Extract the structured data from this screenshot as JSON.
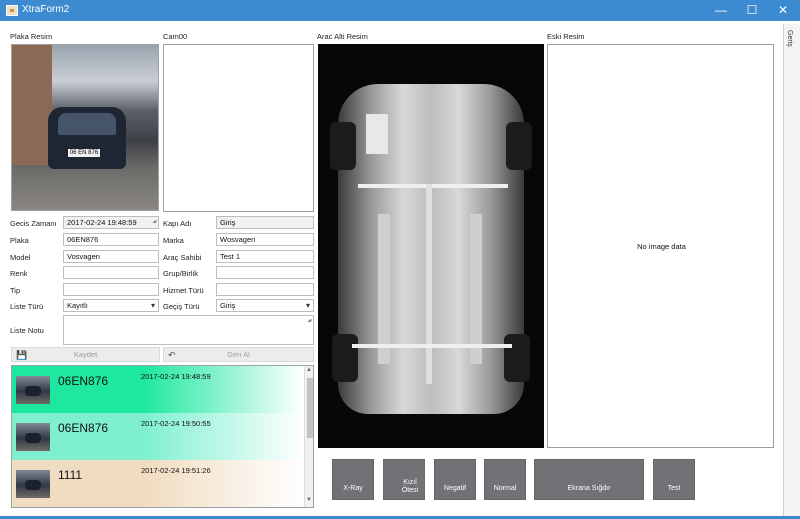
{
  "window": {
    "title": "XtraForm2",
    "minimize": "—",
    "maximize": "☐",
    "close": "✕"
  },
  "side_tab": "Geriş",
  "panels": {
    "plaka_resim": "Plaka Resim",
    "cam": "Cam00",
    "arac_alti": "Arac Alti Resim",
    "eski_resim": "Eski Resim",
    "no_image": "No image data",
    "plate_in_photo": "06 EN 876"
  },
  "form": {
    "gecis_zamani": {
      "label": "Gecis Zamanı",
      "value": "2017-02-24 19:48:59"
    },
    "plaka": {
      "label": "Plaka",
      "value": "06EN876"
    },
    "model": {
      "label": "Model",
      "value": "Vosvagen"
    },
    "renk": {
      "label": "Renk",
      "value": ""
    },
    "tip": {
      "label": "Tip",
      "value": ""
    },
    "liste_turu": {
      "label": "Liste Türü",
      "value": "Kayıtlı"
    },
    "liste_notu": {
      "label": "Liste Notu",
      "value": ""
    },
    "kapi_adi": {
      "label": "Kapı Adı",
      "value": "Giriş"
    },
    "marka": {
      "label": "Marka",
      "value": "Wosvagen"
    },
    "arac_sahibi": {
      "label": "Araç Sahibi",
      "value": "Test 1"
    },
    "grup_birlik": {
      "label": "Grup/Birlik",
      "value": ""
    },
    "hizmet_turu": {
      "label": "Hizmet Türü",
      "value": ""
    },
    "gecis_turu": {
      "label": "Geçiş Türü",
      "value": "Giriş"
    }
  },
  "actions": {
    "save": "Kaydet",
    "undo": "Geri Al",
    "save_icon": "💾",
    "undo_icon": "↶"
  },
  "list": [
    {
      "plate": "06EN876",
      "time": "2017-02-24 19:48:59",
      "color": "#1ee8a0"
    },
    {
      "plate": "06EN876",
      "time": "2017-02-24 19:50:55",
      "color": "#7ef0d0"
    },
    {
      "plate": "1111",
      "time": "2017-02-24 19:51:26",
      "color": "#f0dcc0"
    }
  ],
  "toolbar": {
    "xray": "X-Ray",
    "kizil_otesi_1": "Kızıl",
    "kizil_otesi_2": "Ötesi",
    "negatif": "Negatif",
    "normal": "Normal",
    "ekrana_sigdir": "Ekrana Sığdır",
    "test": "Test"
  }
}
